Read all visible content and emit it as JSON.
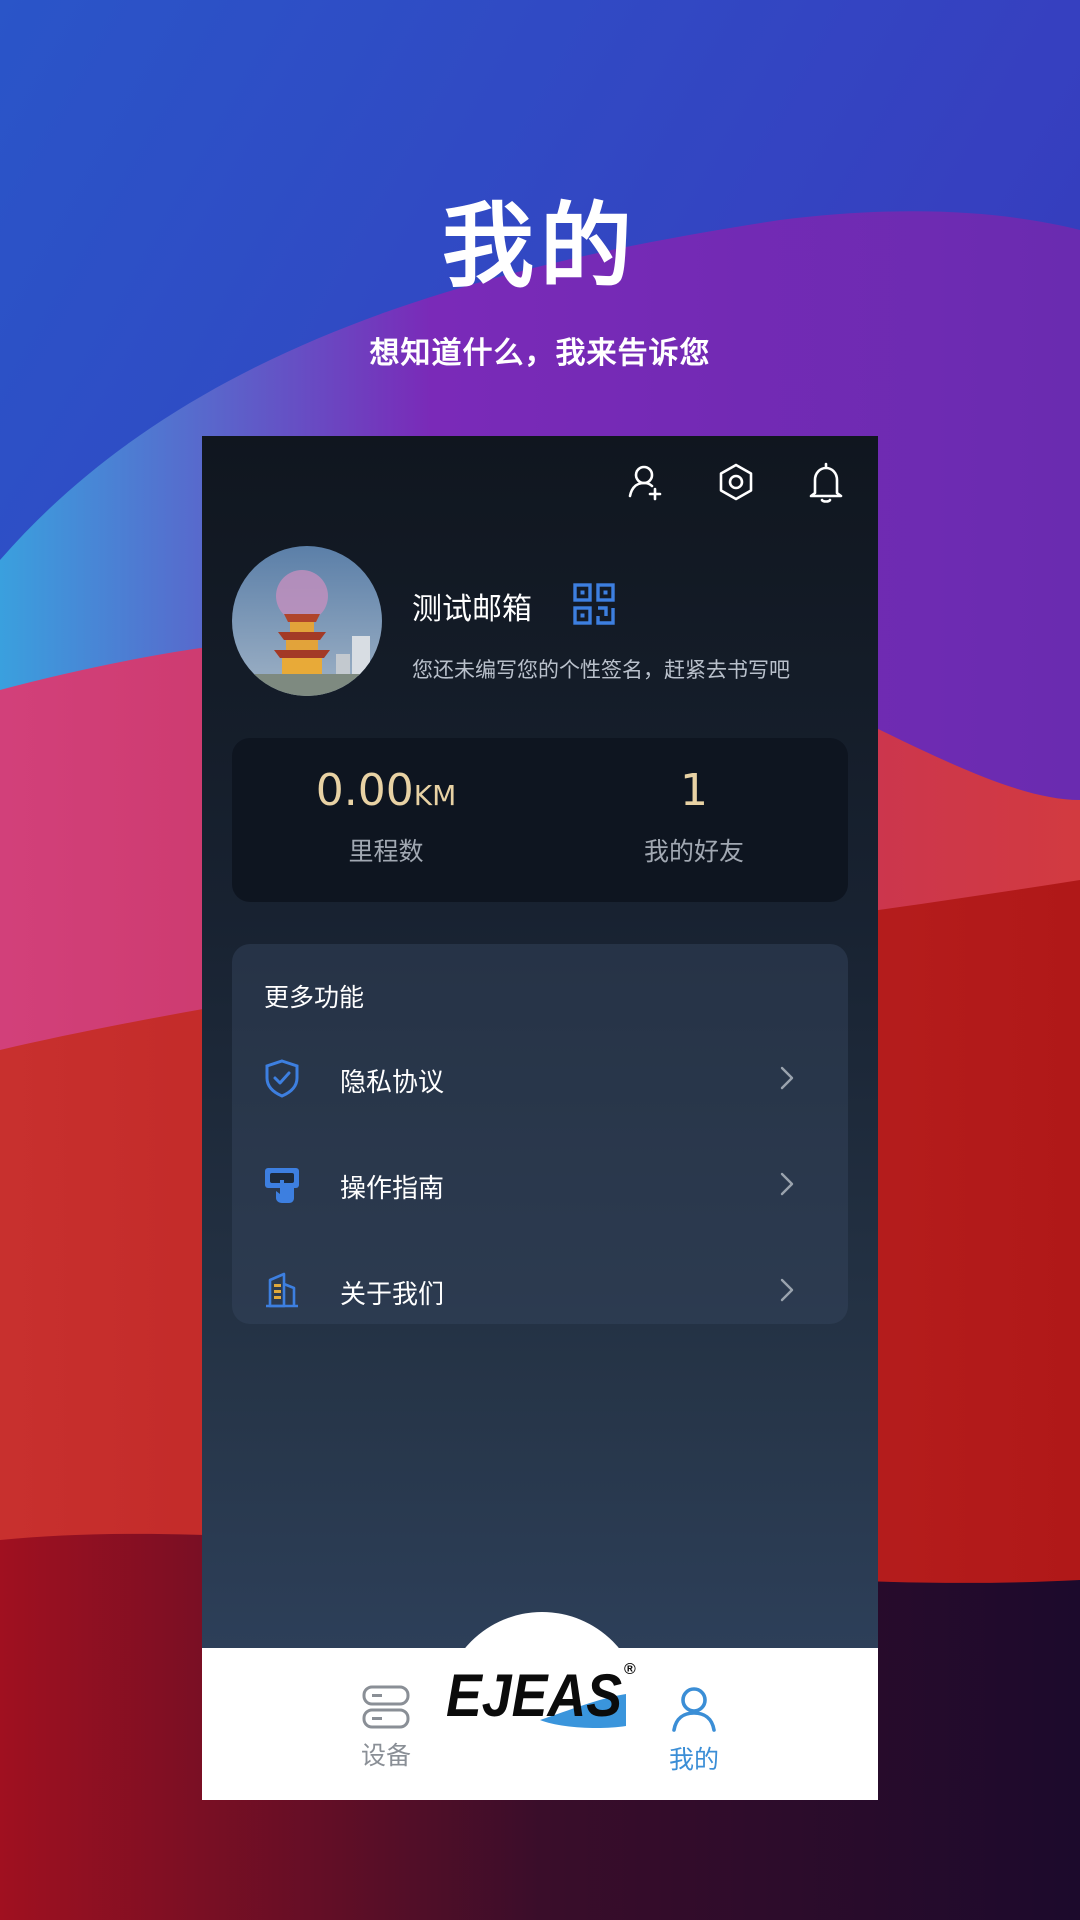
{
  "promo": {
    "title": "我的",
    "subtitle": "想知道什么，我来告诉您"
  },
  "header_icons": [
    "add-friend-icon",
    "settings-icon",
    "bell-icon"
  ],
  "profile": {
    "name": "测试邮箱",
    "signature": "您还未编写您的个性签名，赶紧去书写吧"
  },
  "stats": {
    "mileage_value": "0.00",
    "mileage_unit": "KM",
    "mileage_label": "里程数",
    "friends_value": "1",
    "friends_label": "我的好友"
  },
  "more": {
    "title": "更多功能",
    "items": [
      {
        "label": "隐私协议",
        "icon": "shield-icon"
      },
      {
        "label": "操作指南",
        "icon": "guide-icon"
      },
      {
        "label": "关于我们",
        "icon": "building-icon"
      }
    ]
  },
  "tabbar": {
    "devices_label": "设备",
    "logo_text": "EJEAS",
    "logo_mark": "®",
    "me_label": "我的",
    "active_color": "#3b8ed6",
    "inactive_color": "#8a8f96"
  },
  "colors": {
    "accent": "#3d7fe0",
    "stat_value": "#e8d2a4"
  }
}
